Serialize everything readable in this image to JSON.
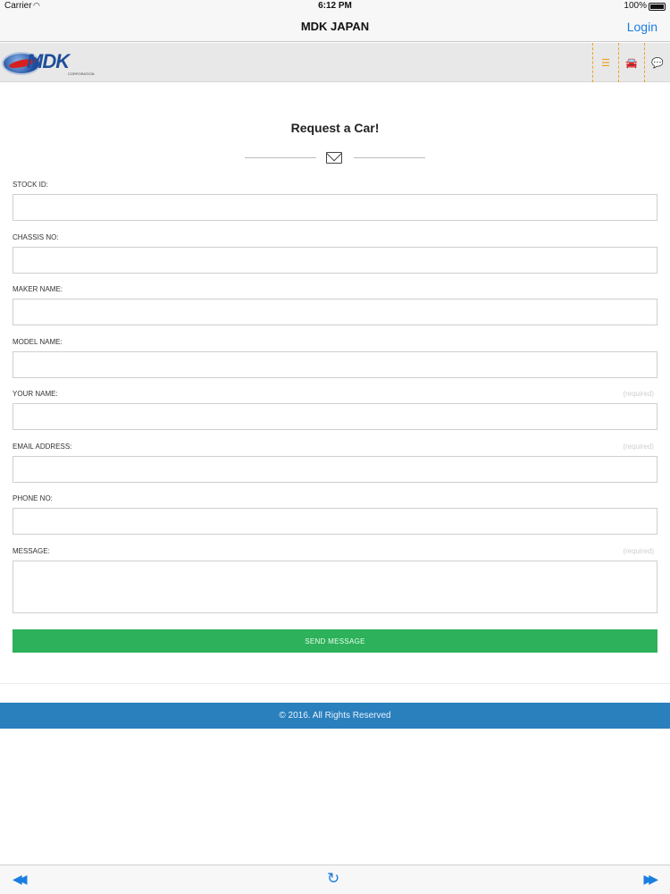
{
  "status_bar": {
    "carrier": "Carrier",
    "time": "6:12 PM",
    "battery": "100%"
  },
  "nav": {
    "title": "MDK JAPAN",
    "login": "Login"
  },
  "site": {
    "logo_text": "MDK",
    "logo_sub": "CORPORATION",
    "icons": [
      "menu-icon",
      "car-icon",
      "chat-icon"
    ]
  },
  "form": {
    "title": "Request a Car!",
    "fields": [
      {
        "label": "STOCK ID:",
        "required": ""
      },
      {
        "label": "CHASSIS NO:",
        "required": ""
      },
      {
        "label": "MAKER NAME:",
        "required": ""
      },
      {
        "label": "MODEL NAME:",
        "required": ""
      },
      {
        "label": "YOUR NAME:",
        "required": "(required)"
      },
      {
        "label": "EMAIL ADDRESS:",
        "required": "(required)"
      },
      {
        "label": "PHONE NO:",
        "required": ""
      },
      {
        "label": "MESSAGE:",
        "required": "(required)"
      }
    ],
    "submit": "SEND MESSAGE"
  },
  "footer": {
    "copyright": "© 2016. All Rights Reserved"
  },
  "colors": {
    "accent": "#f0a020",
    "button": "#2db15a",
    "footer": "#2a7fbd",
    "link": "#1a7de0"
  }
}
